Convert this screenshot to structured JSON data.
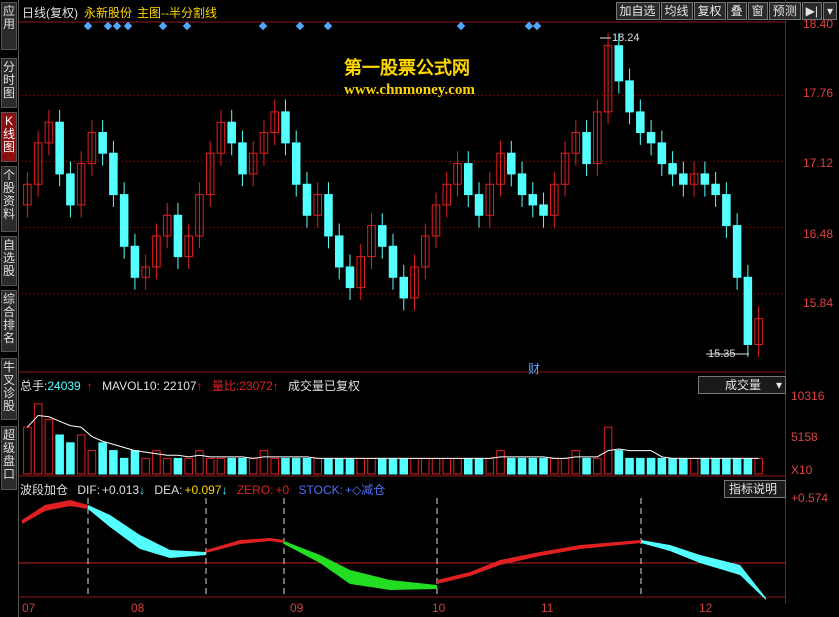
{
  "sidebar": {
    "tabs": [
      {
        "label": "应用"
      },
      {
        "label": "分时图"
      },
      {
        "label": "K线图",
        "active": true
      },
      {
        "label": "个股资料"
      },
      {
        "label": "自选股"
      },
      {
        "label": "综合排名"
      },
      {
        "label": "牛叉诊股"
      },
      {
        "label": "超级盘口"
      }
    ]
  },
  "header": {
    "period": "日线(复权)",
    "stock_name": "永新股份",
    "main_chart": "主图--半分割线"
  },
  "toolbar": {
    "add_watchlist": "加自选",
    "ma_lines": "均线",
    "restore_rights": "复权",
    "overlay": "叠",
    "window": "窗",
    "forecast": "预测",
    "arrow": "▶|",
    "menu": "▾"
  },
  "watermark": {
    "line1": "第一股票公式网",
    "line2": "www.chnmoney.com"
  },
  "price_axis": {
    "labels": [
      "18.40",
      "17.76",
      "17.12",
      "16.48",
      "15.84"
    ],
    "high_marker": "18.24",
    "low_marker": "15.35",
    "finance_mark": "财"
  },
  "volume_panel": {
    "total_label": "总手:",
    "total_value": "24039",
    "mavol_label": "MAVOL10:",
    "mavol_value": "22107",
    "ratio_label": "量比:",
    "ratio_value": "23072",
    "note": "成交量已复权",
    "dropdown": "成交量",
    "axis_labels": [
      "10316",
      "5158"
    ],
    "unit": "X10"
  },
  "indicator_panel": {
    "name": "波段加仓",
    "dif_label": "DIF:",
    "dif_value": "+0.013",
    "dea_label": "DEA:",
    "dea_value": "+0.097",
    "zero_label": "ZERO:",
    "zero_value": "+0",
    "stock_label": "STOCK:",
    "stock_value": "+◇减仓",
    "help_button": "指标说明",
    "axis_label": "+0.574"
  },
  "time_axis": {
    "months": [
      "07",
      "08",
      "09",
      "10",
      "11",
      "12"
    ]
  },
  "colors": {
    "up": "#e02020",
    "down": "#54ffff",
    "ma": "#ffffff",
    "grid": "#8a1a1a",
    "diamond": "#4fa8ff"
  },
  "chart_data": {
    "type": "candlestick",
    "ylim": [
      15.2,
      18.45
    ],
    "close_series": [
      16.9,
      17.3,
      17.5,
      17.0,
      16.7,
      17.1,
      17.4,
      17.2,
      16.8,
      16.3,
      16.0,
      16.1,
      16.4,
      16.6,
      16.2,
      16.4,
      16.8,
      17.2,
      17.5,
      17.3,
      17.0,
      17.2,
      17.4,
      17.6,
      17.3,
      16.9,
      16.6,
      16.8,
      16.4,
      16.1,
      15.9,
      16.2,
      16.5,
      16.3,
      16.0,
      15.8,
      16.1,
      16.4,
      16.7,
      16.9,
      17.1,
      16.8,
      16.6,
      16.9,
      17.2,
      17.0,
      16.8,
      16.7,
      16.6,
      16.9,
      17.2,
      17.4,
      17.1,
      17.6,
      18.24,
      17.9,
      17.6,
      17.4,
      17.3,
      17.1,
      17.0,
      16.9,
      17.0,
      16.9,
      16.8,
      16.5,
      16.0,
      15.35,
      15.6
    ],
    "volume_series": [
      6,
      9,
      7,
      5,
      4,
      5,
      3,
      4,
      3,
      2,
      3,
      2,
      3,
      2,
      2,
      2,
      3,
      2,
      2,
      2,
      2,
      2,
      3,
      2,
      2,
      2,
      2,
      2,
      2,
      2,
      2,
      2,
      2,
      2,
      2,
      2,
      2,
      2,
      2,
      2,
      2,
      2,
      2,
      2,
      3,
      2,
      2,
      2,
      2,
      2,
      2,
      3,
      2,
      2,
      6,
      3,
      2,
      2,
      2,
      2,
      2,
      2,
      2,
      2,
      2,
      2,
      2,
      2,
      2
    ]
  }
}
